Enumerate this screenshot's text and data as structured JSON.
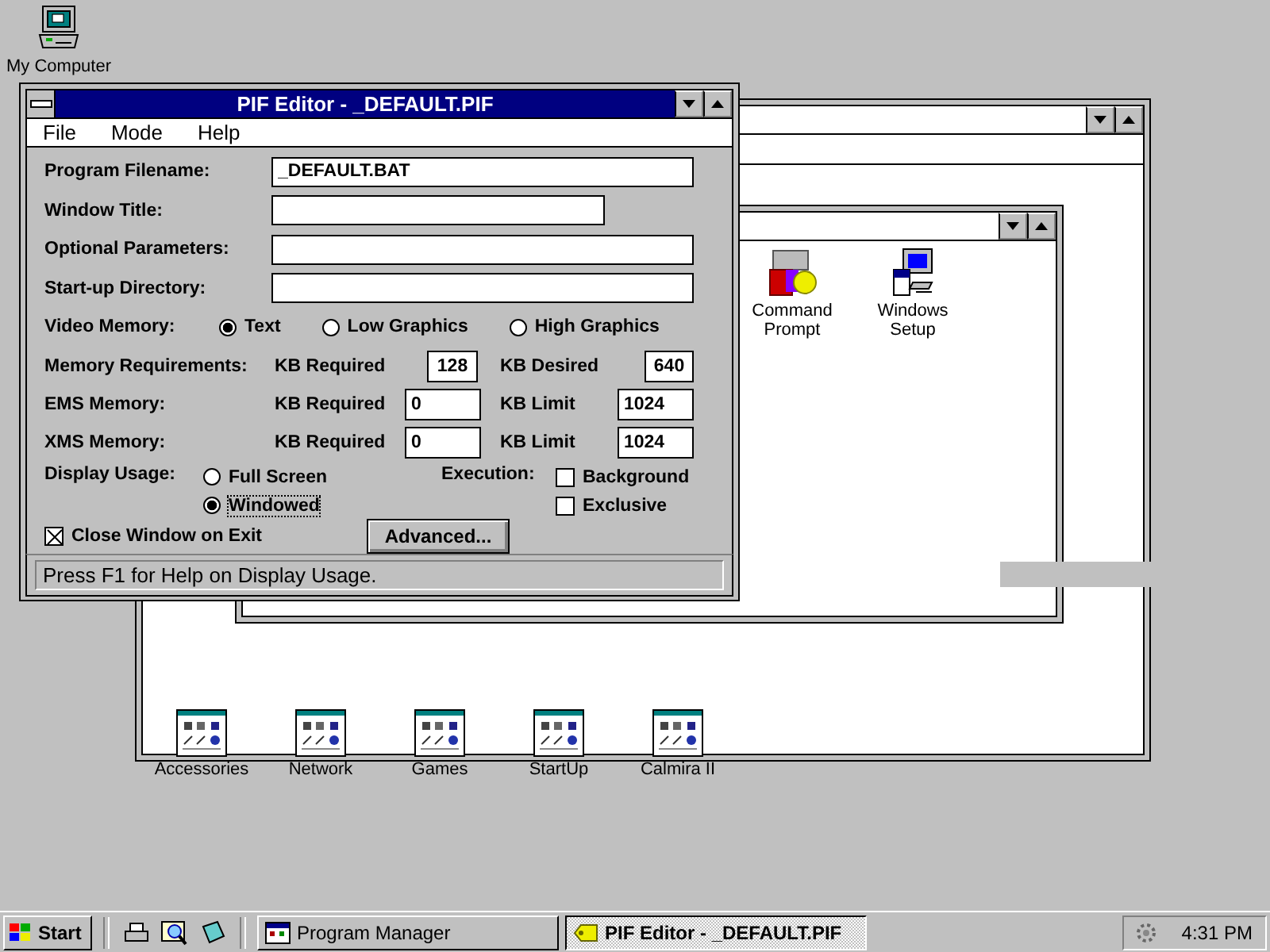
{
  "desktop_icons": [
    {
      "label": "My Computer"
    }
  ],
  "program_manager": {
    "group_items": [
      {
        "label": "Command Prompt",
        "kind": "dos"
      },
      {
        "label": "Windows Setup",
        "kind": "setup"
      }
    ],
    "groups": [
      {
        "label": "Accessories"
      },
      {
        "label": "Network"
      },
      {
        "label": "Games"
      },
      {
        "label": "StartUp"
      },
      {
        "label": "Calmira II"
      }
    ]
  },
  "pif_editor": {
    "title": "PIF Editor - _DEFAULT.PIF",
    "menu": [
      "File",
      "Mode",
      "Help"
    ],
    "fields": [
      {
        "label": "Program Filename:",
        "value": "_DEFAULT.BAT",
        "kind": "long"
      },
      {
        "label": "Window Title:",
        "kind": "short"
      },
      {
        "label": "Optional Parameters:",
        "kind": "long"
      },
      {
        "label": "Start-up Directory:",
        "kind": "long"
      }
    ],
    "video_memory": {
      "label": "Video Memory:",
      "options": [
        {
          "label": "Text",
          "selected": true
        },
        {
          "label": "Low Graphics",
          "selected": false
        },
        {
          "label": "High Graphics",
          "selected": false
        }
      ]
    },
    "memory_rows": [
      {
        "label": "Memory Requirements:",
        "kind": "fixed",
        "required_label": "KB Required",
        "required": "128",
        "limit_label": "KB Desired",
        "limit": "640"
      },
      {
        "label": "EMS Memory:",
        "kind": "range",
        "required_label": "KB Required",
        "required": "0",
        "limit_label": "KB Limit",
        "limit": "1024"
      },
      {
        "label": "XMS Memory:",
        "kind": "range",
        "required_label": "KB Required",
        "required": "0",
        "limit_label": "KB Limit",
        "limit": "1024"
      }
    ],
    "display_usage": {
      "label": "Display Usage:",
      "options": [
        {
          "label": "Full Screen",
          "selected": false,
          "focused": false
        },
        {
          "label": "Windowed",
          "selected": true,
          "focused": true
        }
      ]
    },
    "execution": {
      "label": "Execution:",
      "options": [
        {
          "label": "Background",
          "checked": false
        },
        {
          "label": "Exclusive",
          "checked": false
        }
      ]
    },
    "close_on_exit": {
      "label": "Close Window on Exit",
      "checked": true
    },
    "advanced_button": "Advanced...",
    "status": "Press F1 for Help on Display Usage."
  },
  "taskbar": {
    "start": "Start",
    "buttons": [
      {
        "label": "Program Manager",
        "selected": false,
        "kind": "progman"
      },
      {
        "label": "PIF Editor - _DEFAULT.PIF",
        "selected": true,
        "kind": "pif"
      }
    ],
    "clock": "4:31 PM"
  }
}
